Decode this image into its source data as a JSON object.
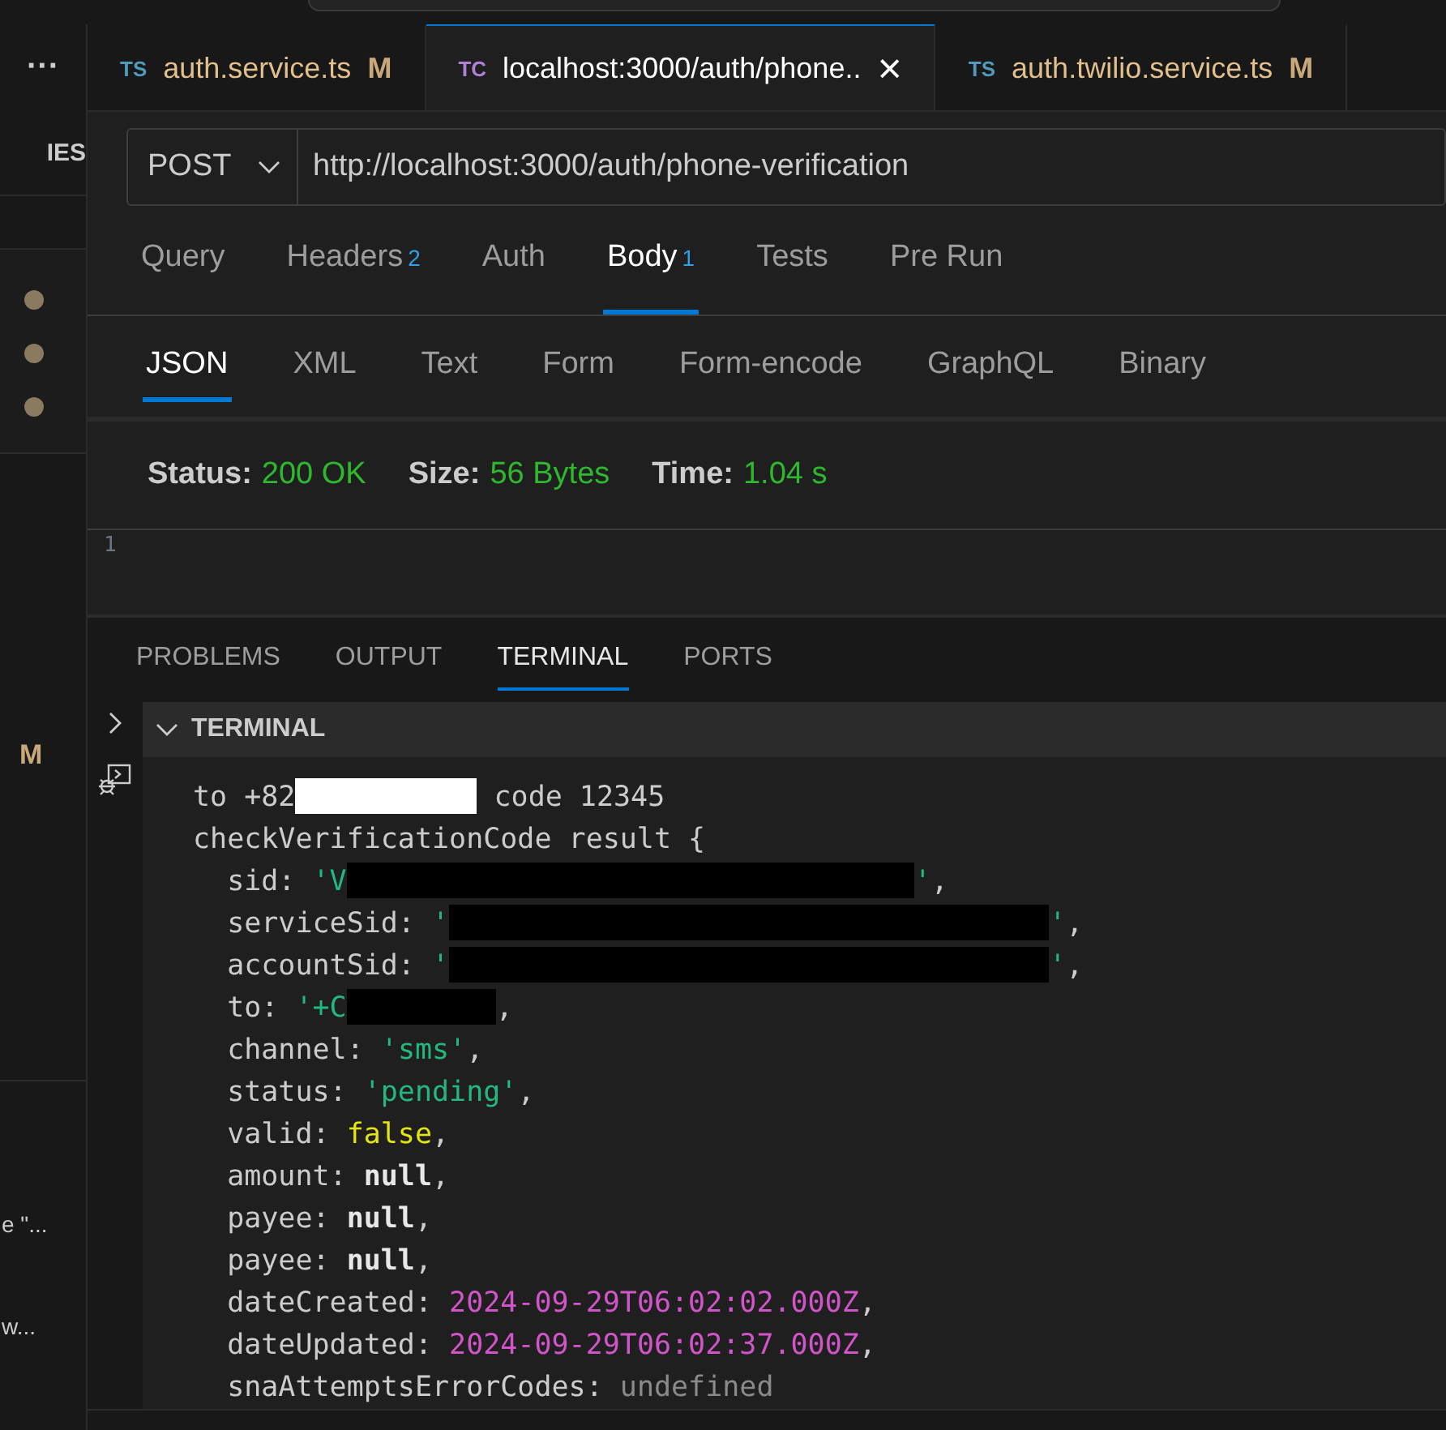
{
  "sidebar": {
    "more_label": "···",
    "heading": "IES",
    "dots": [
      {
        "color": "#8a7a60"
      },
      {
        "color": "#8a7a60"
      },
      {
        "color": "#8a7a60"
      }
    ],
    "modified_badge": "M",
    "snippets": [
      "e \"...",
      "w..."
    ]
  },
  "editor_tabs": [
    {
      "badge": "TS",
      "color": "#519aba",
      "label": "auth.service.ts",
      "status": "M",
      "selected": false
    },
    {
      "badge": "TC",
      "color": "#b180d7",
      "label": "localhost:3000/auth/phone..",
      "close": "×",
      "selected": true
    },
    {
      "badge": "TS",
      "color": "#519aba",
      "label": "auth.twilio.service.ts",
      "status": "M",
      "selected": false
    }
  ],
  "request": {
    "method": "POST",
    "url": "http://localhost:3000/auth/phone-verification"
  },
  "request_tabs": [
    {
      "label": "Query",
      "selected": false
    },
    {
      "label": "Headers",
      "count": "2",
      "selected": false
    },
    {
      "label": "Auth",
      "selected": false
    },
    {
      "label": "Body",
      "count": "1",
      "selected": true
    },
    {
      "label": "Tests",
      "selected": false
    },
    {
      "label": "Pre Run",
      "selected": false
    }
  ],
  "body_tabs": [
    {
      "label": "JSON",
      "selected": true
    },
    {
      "label": "XML",
      "selected": false
    },
    {
      "label": "Text",
      "selected": false
    },
    {
      "label": "Form",
      "selected": false
    },
    {
      "label": "Form-encode",
      "selected": false
    },
    {
      "label": "GraphQL",
      "selected": false
    },
    {
      "label": "Binary",
      "selected": false
    }
  ],
  "response": [
    {
      "label": "Status:",
      "value": "200 OK"
    },
    {
      "label": "Size:",
      "value": "56 Bytes"
    },
    {
      "label": "Time:",
      "value": "1.04 s"
    }
  ],
  "editor": {
    "line_number": "1"
  },
  "panel_tabs": [
    {
      "label": "PROBLEMS",
      "selected": false
    },
    {
      "label": "OUTPUT",
      "selected": false
    },
    {
      "label": "TERMINAL",
      "selected": true
    },
    {
      "label": "PORTS",
      "selected": false
    }
  ],
  "terminal": {
    "title": "TERMINAL",
    "lines": [
      [
        {
          "kind": "plain",
          "text": "to +82"
        },
        {
          "kind": "redact_light"
        },
        {
          "kind": "plain",
          "text": " code 12345"
        }
      ],
      [
        {
          "kind": "plain",
          "text": "checkVerificationCode result {"
        }
      ],
      [
        {
          "kind": "plain",
          "text": "  sid: "
        },
        {
          "kind": "string",
          "text": "'V"
        },
        {
          "kind": "redact"
        },
        {
          "kind": "string",
          "text": "'"
        },
        {
          "kind": "plain",
          "text": ","
        }
      ],
      [
        {
          "kind": "plain",
          "text": "  serviceSid: "
        },
        {
          "kind": "string",
          "text": "'"
        },
        {
          "kind": "redact"
        },
        {
          "kind": "string",
          "text": "'"
        },
        {
          "kind": "plain",
          "text": ","
        }
      ],
      [
        {
          "kind": "plain",
          "text": "  accountSid: "
        },
        {
          "kind": "string",
          "text": "'"
        },
        {
          "kind": "redact"
        },
        {
          "kind": "string",
          "text": "'"
        },
        {
          "kind": "plain",
          "text": ","
        }
      ],
      [
        {
          "kind": "plain",
          "text": "  to: "
        },
        {
          "kind": "string",
          "text": "'+C"
        },
        {
          "kind": "redact"
        },
        {
          "kind": "plain",
          "text": ","
        }
      ],
      [
        {
          "kind": "plain",
          "text": "  channel: "
        },
        {
          "kind": "string",
          "text": "'sms'"
        },
        {
          "kind": "plain",
          "text": ","
        }
      ],
      [
        {
          "kind": "plain",
          "text": "  status: "
        },
        {
          "kind": "string",
          "text": "'pending'"
        },
        {
          "kind": "plain",
          "text": ","
        }
      ],
      [
        {
          "kind": "plain",
          "text": "  valid: "
        },
        {
          "kind": "boolean",
          "text": "false"
        },
        {
          "kind": "plain",
          "text": ","
        }
      ],
      [
        {
          "kind": "plain",
          "text": "  amount: "
        },
        {
          "kind": "null",
          "text": "null"
        },
        {
          "kind": "plain",
          "text": ","
        }
      ],
      [
        {
          "kind": "plain",
          "text": "  payee: "
        },
        {
          "kind": "null",
          "text": "null"
        },
        {
          "kind": "plain",
          "text": ","
        }
      ],
      [
        {
          "kind": "plain",
          "text": "  payee: "
        },
        {
          "kind": "null",
          "text": "null"
        },
        {
          "kind": "plain",
          "text": ","
        }
      ],
      [
        {
          "kind": "plain",
          "text": "  dateCreated: "
        },
        {
          "kind": "date",
          "text": "2024-09-29T06:02:02.000Z"
        },
        {
          "kind": "plain",
          "text": ","
        }
      ],
      [
        {
          "kind": "plain",
          "text": "  dateUpdated: "
        },
        {
          "kind": "date",
          "text": "2024-09-29T06:02:37.000Z"
        },
        {
          "kind": "plain",
          "text": ","
        }
      ],
      [
        {
          "kind": "plain",
          "text": "  snaAttemptsErrorCodes: "
        },
        {
          "kind": "undefined",
          "text": "undefined"
        }
      ]
    ]
  }
}
